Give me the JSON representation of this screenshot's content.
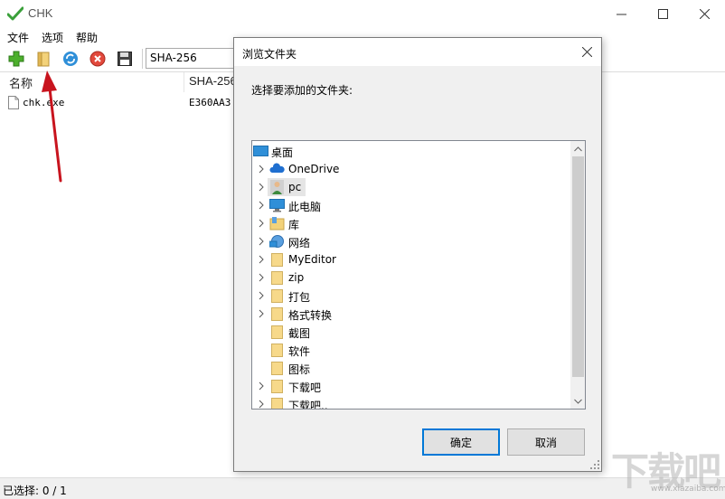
{
  "app": {
    "title": "CHK",
    "menu": [
      "文件",
      "选项",
      "帮助"
    ],
    "toolbar": {
      "algorithm": "SHA-256",
      "buttons": [
        "add-icon",
        "open-folder-icon",
        "refresh-icon",
        "stop-icon",
        "save-icon"
      ]
    },
    "list": {
      "columns": [
        "名称",
        "SHA-256"
      ],
      "rows": [
        {
          "name": "chk.exe",
          "hash": "E360AA3"
        }
      ]
    },
    "status": "已选择: 0 / 1"
  },
  "dialog": {
    "title": "浏览文件夹",
    "prompt": "选择要添加的文件夹:",
    "tree": [
      {
        "label": "桌面",
        "icon": "desktop-icon"
      },
      {
        "label": "OneDrive",
        "icon": "cloud-icon"
      },
      {
        "label": "pc",
        "icon": "user-icon"
      },
      {
        "label": "此电脑",
        "icon": "computer-icon"
      },
      {
        "label": "库",
        "icon": "library-icon"
      },
      {
        "label": "网络",
        "icon": "network-icon"
      },
      {
        "label": "MyEditor",
        "icon": "folder-icon"
      },
      {
        "label": "zip",
        "icon": "folder-icon"
      },
      {
        "label": "打包",
        "icon": "folder-icon"
      },
      {
        "label": "格式转换",
        "icon": "folder-icon"
      },
      {
        "label": "截图",
        "icon": "folder-icon"
      },
      {
        "label": "软件",
        "icon": "folder-icon"
      },
      {
        "label": "图标",
        "icon": "folder-icon"
      },
      {
        "label": "下载吧",
        "icon": "folder-icon"
      },
      {
        "label": "下载吧..",
        "icon": "folder-icon"
      }
    ],
    "ok": "确定",
    "cancel": "取消"
  },
  "watermark": {
    "text": "下载吧",
    "sub": "www.xiazaiba.com"
  }
}
